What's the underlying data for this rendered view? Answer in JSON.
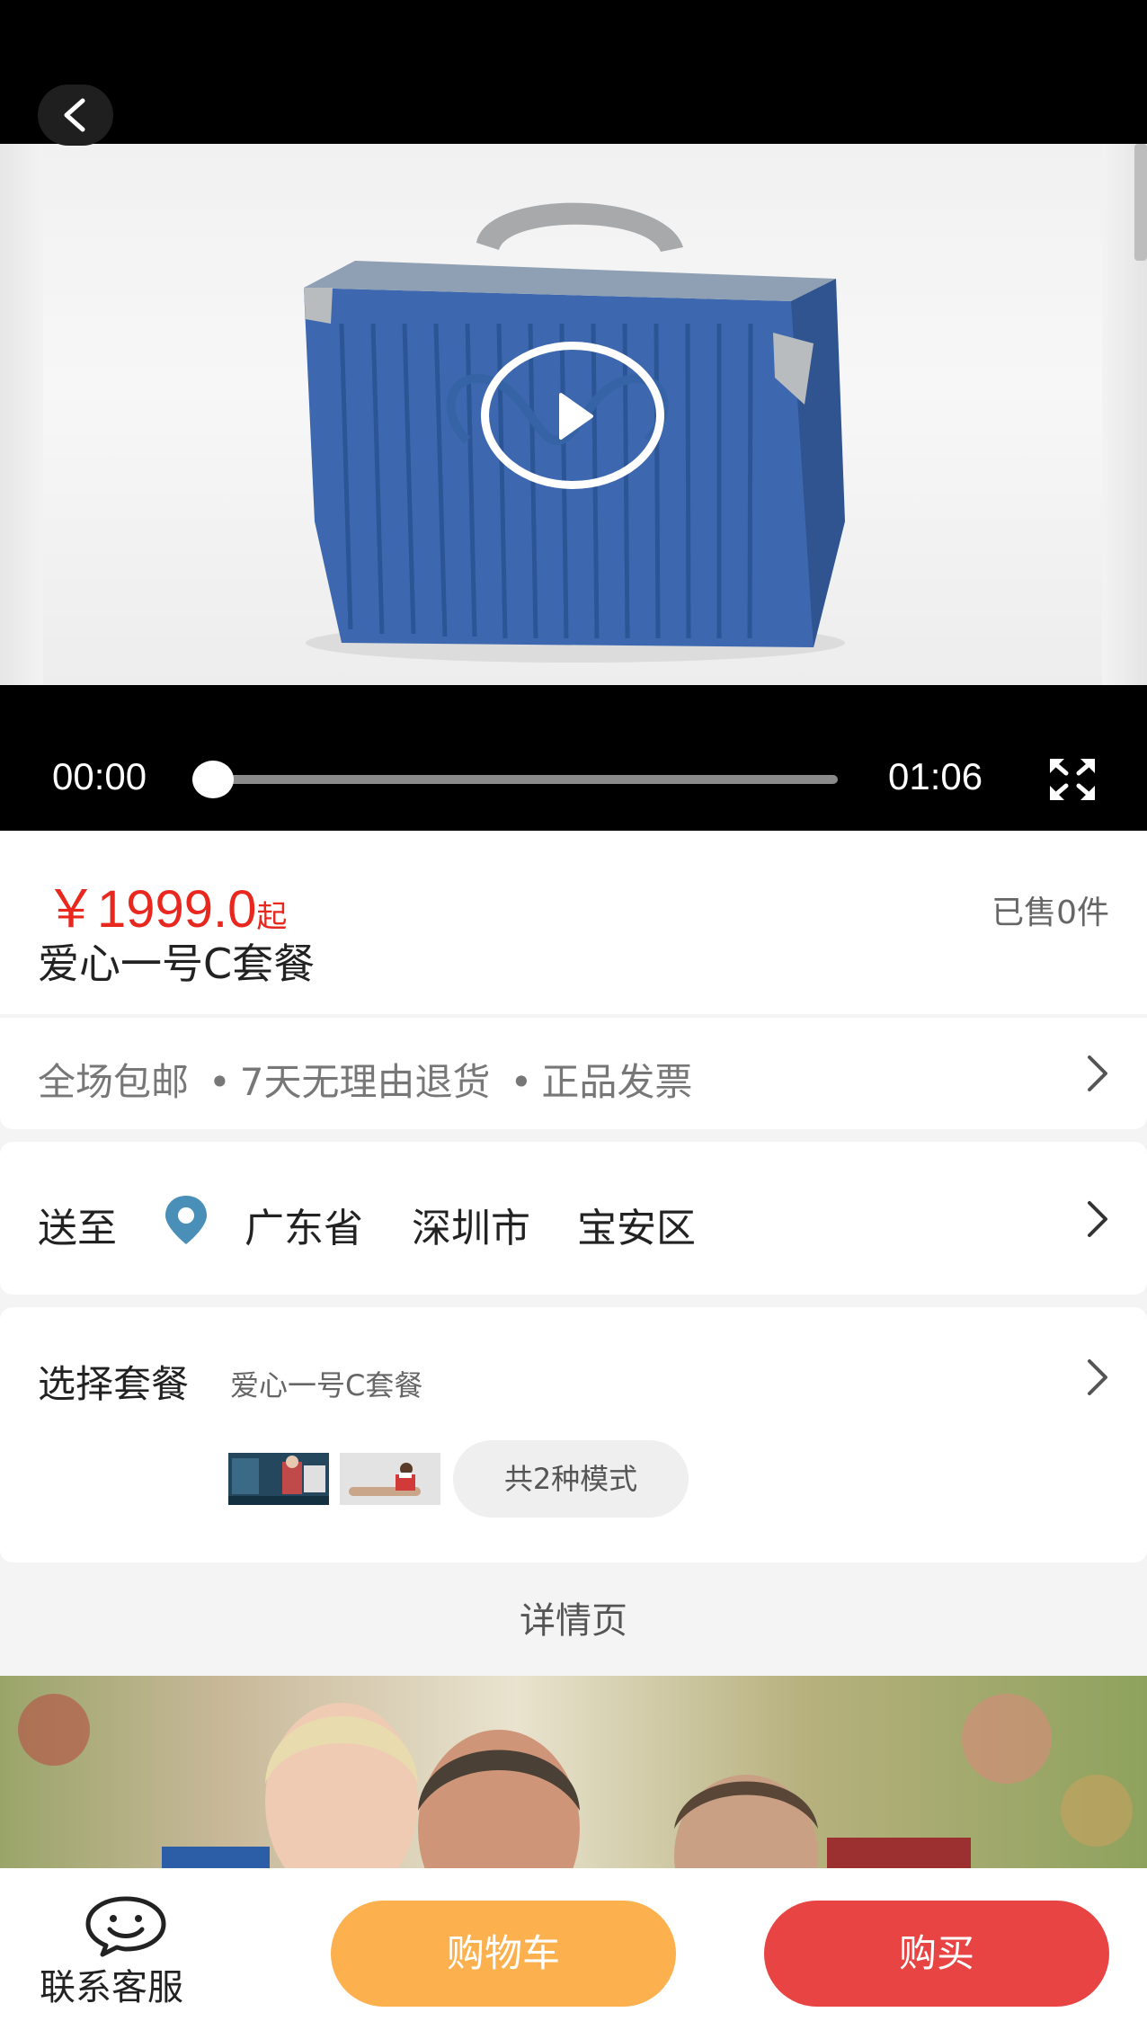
{
  "video": {
    "current_time": "00:00",
    "duration": "01:06",
    "progress": 0.0
  },
  "product": {
    "currency": "￥",
    "price": "1999.0",
    "price_suffix": "起",
    "sold": "已售0件",
    "title": "爱心一号C套餐"
  },
  "service": {
    "items": [
      "全场包邮",
      "7天无理由退货",
      "正品发票"
    ]
  },
  "delivery": {
    "label": "送至",
    "province": "广东省",
    "city": "深圳市",
    "district": "宝安区"
  },
  "package": {
    "label": "选择套餐",
    "selected": "爱心一号C套餐",
    "modes": "共2种模式"
  },
  "detail": {
    "label": "详情页"
  },
  "bottom": {
    "service_label": "联系客服",
    "cart_label": "购物车",
    "buy_label": "购买"
  },
  "colors": {
    "price_red": "#e8281f",
    "cart_orange": "#fcb04e",
    "buy_red": "#e84444",
    "pin_blue": "#4a8fb8"
  },
  "icons": [
    "back-icon",
    "play-icon",
    "fullscreen-icon",
    "chevron-right-icon",
    "location-pin-icon",
    "smiley-chat-icon"
  ]
}
